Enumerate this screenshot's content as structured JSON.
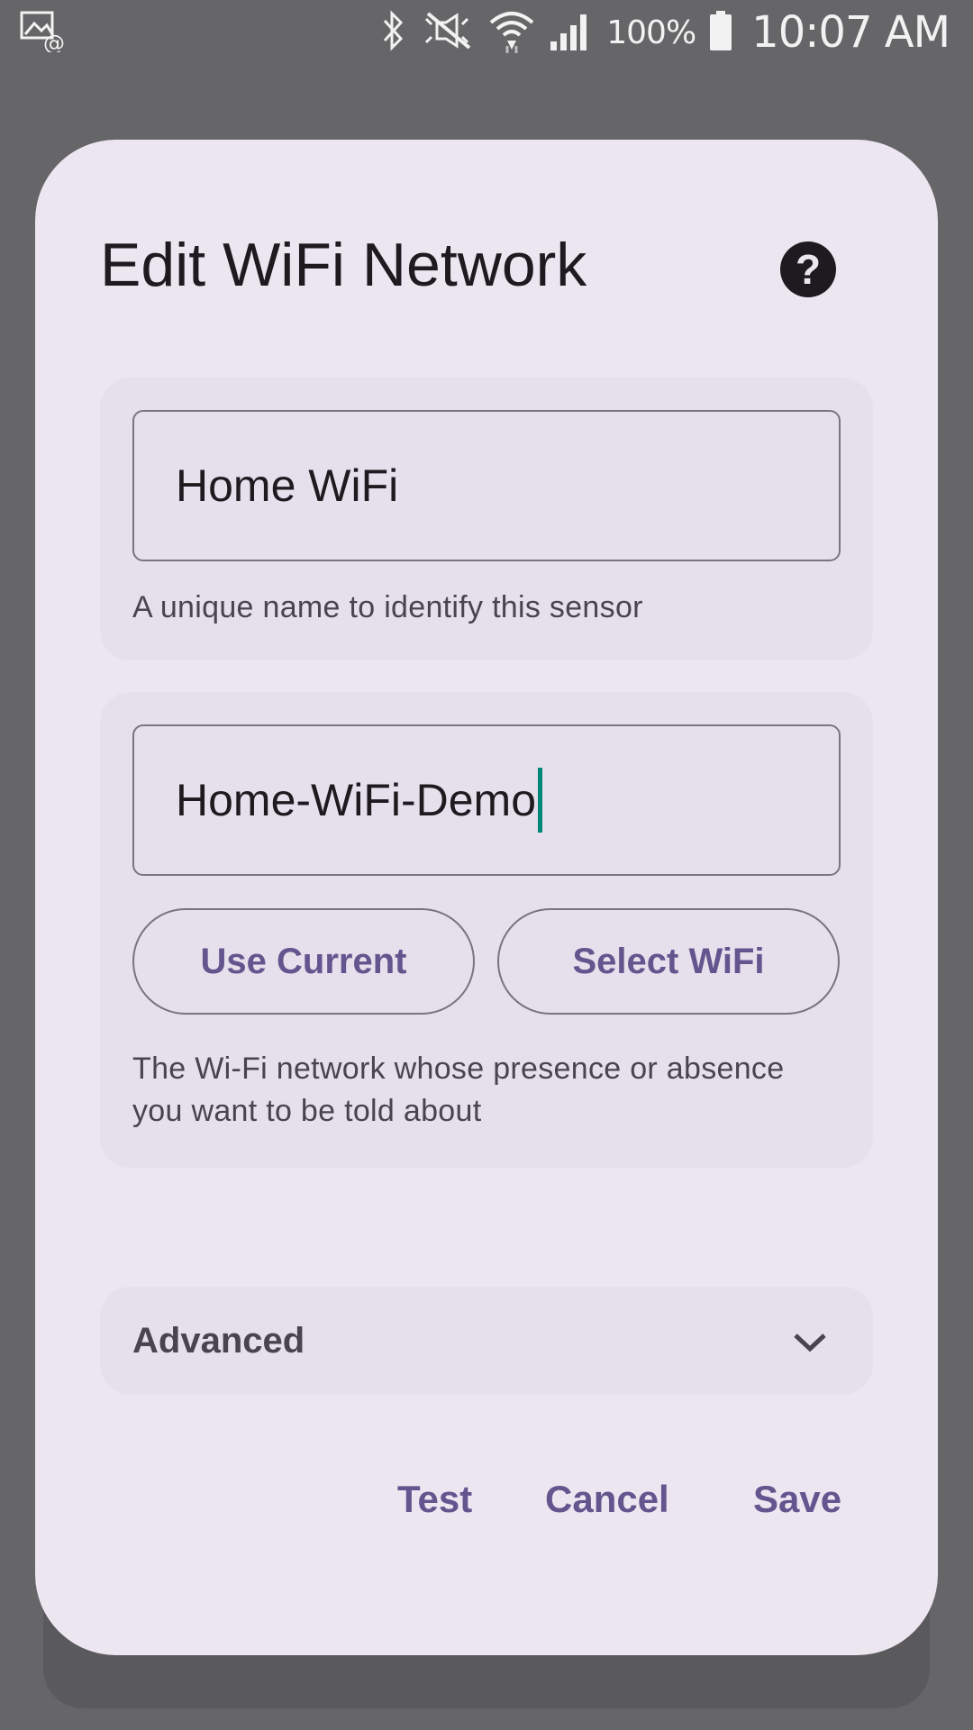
{
  "status_bar": {
    "battery_percent": "100%",
    "time": "10:07 AM",
    "icons": [
      "screen-mirror-icon",
      "bluetooth-icon",
      "silent-icon",
      "wifi-icon",
      "signal-icon",
      "battery-icon"
    ]
  },
  "dialog": {
    "title": "Edit WiFi Network",
    "help_glyph": "?",
    "name_field": {
      "value": "Home WiFi",
      "helper": "A unique name to identify this sensor"
    },
    "ssid_field": {
      "value": "Home-WiFi-Demo",
      "use_current_label": "Use Current",
      "select_wifi_label": "Select WiFi",
      "helper": "The Wi-Fi network whose presence or absence you want to be told about"
    },
    "advanced_label": "Advanced",
    "actions": {
      "test": "Test",
      "cancel": "Cancel",
      "save": "Save"
    }
  },
  "colors": {
    "scrim": "#666568",
    "dialog_bg": "#ece6f1",
    "section_bg": "#e6e0ec",
    "accent": "#65558f",
    "cursor": "#00897b"
  }
}
